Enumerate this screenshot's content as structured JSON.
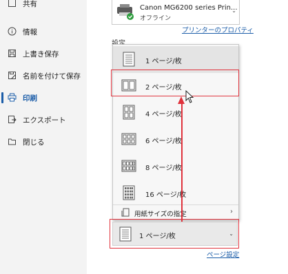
{
  "sidebar": {
    "top_cut_label": "共有",
    "items": [
      {
        "label": "情報",
        "icon": "info-icon"
      },
      {
        "label": "上書き保存",
        "icon": "save-icon"
      },
      {
        "label": "名前を付けて保存",
        "icon": "save-as-icon"
      },
      {
        "label": "印刷",
        "icon": "print-icon",
        "active": true
      },
      {
        "label": "エクスポート",
        "icon": "export-icon"
      },
      {
        "label": "閉じる",
        "icon": "folder-icon"
      }
    ]
  },
  "printer": {
    "name": "Canon MG6200 series Prin...",
    "status": "オフライン",
    "properties_link": "プリンターのプロパティ"
  },
  "settings_label": "設定",
  "pages_per_sheet_menu": {
    "options": [
      {
        "label": "1 ページ/枚",
        "current": true
      },
      {
        "label": "2 ページ/枚",
        "highlighted": true
      },
      {
        "label": "4 ページ/枚"
      },
      {
        "label": "6 ページ/枚"
      },
      {
        "label": "8 ページ/枚"
      },
      {
        "label": "16 ページ/枚"
      }
    ],
    "paper_size_label": "用紙サイズの指定"
  },
  "pages_per_sheet_select": {
    "selected": "1 ページ/枚"
  },
  "page_setup_link": "ページ設定",
  "colors": {
    "accent": "#1a5ca8",
    "annotation": "#e0323c"
  }
}
